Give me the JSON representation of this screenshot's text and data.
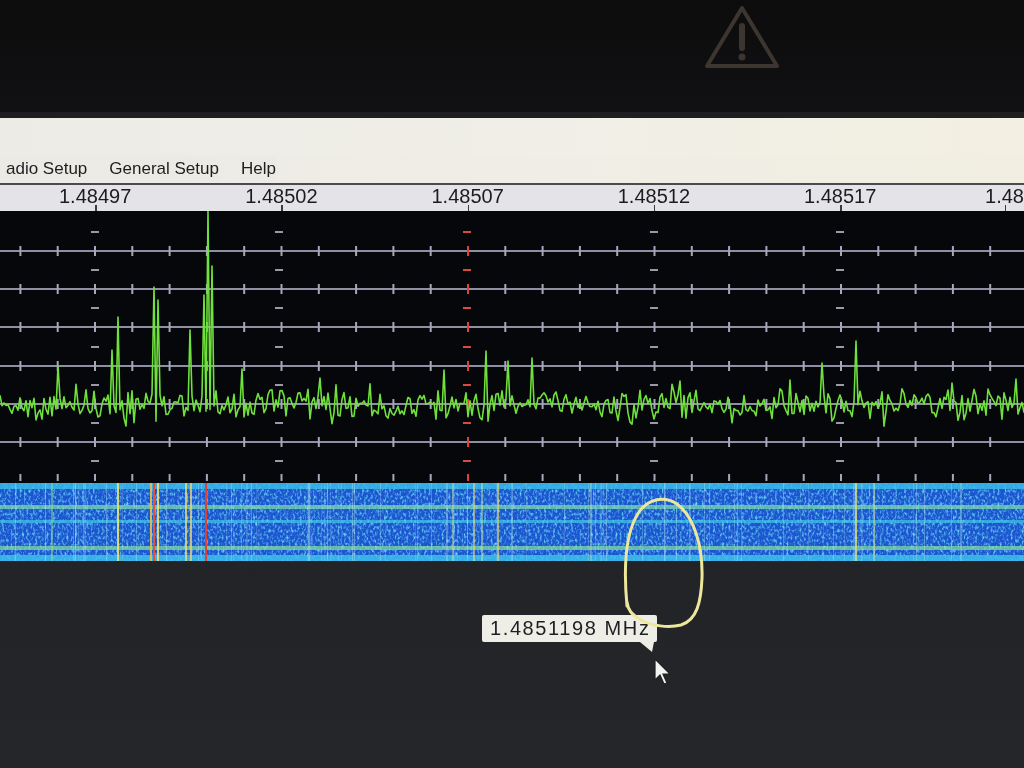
{
  "menu_bar": {
    "items": [
      {
        "label": "adio Setup"
      },
      {
        "label": "General Setup"
      },
      {
        "label": "Help"
      }
    ]
  },
  "frequency_axis": {
    "labels": [
      "1.48497",
      "1.48502",
      "1.48507",
      "1.48512",
      "1.48517",
      "1.48"
    ]
  },
  "tooltip": {
    "text": "1.4851198 MHz"
  }
}
